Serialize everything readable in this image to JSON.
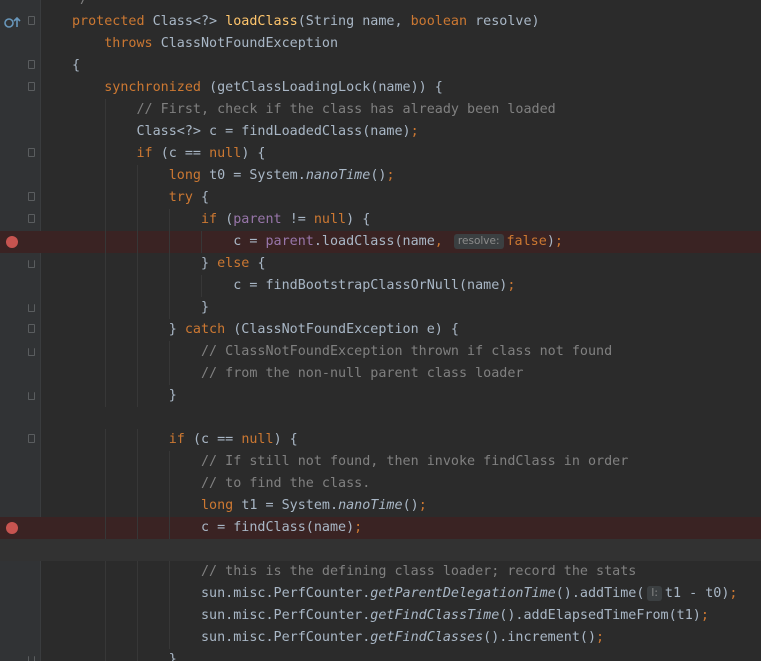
{
  "editor": {
    "lines": [
      {
        "segments": [
          {
            "t": "*/",
            "c": "cm"
          }
        ],
        "indent": 0
      },
      {
        "segments": [
          {
            "t": "protected ",
            "c": "kw"
          },
          {
            "t": "Class<?> "
          },
          {
            "t": "loadClass",
            "c": "fn"
          },
          {
            "t": "(String name, "
          },
          {
            "t": "boolean ",
            "c": "kw"
          },
          {
            "t": "resolve)"
          }
        ]
      },
      {
        "segments": [
          {
            "t": "    throws ",
            "c": "kw"
          },
          {
            "t": "ClassNotFoundException"
          }
        ]
      },
      {
        "segments": [
          {
            "t": "{"
          }
        ]
      },
      {
        "segments": [
          {
            "t": "    synchronized ",
            "c": "kw"
          },
          {
            "t": "(getClassLoadingLock(name)) {"
          }
        ]
      },
      {
        "segments": [
          {
            "t": "        // First, check if the class has already been loaded",
            "c": "cm"
          }
        ]
      },
      {
        "segments": [
          {
            "t": "        Class<?> c = findLoadedClass(name)"
          },
          {
            "t": ";",
            "c": "kw"
          }
        ]
      },
      {
        "segments": [
          {
            "t": "        "
          },
          {
            "t": "if ",
            "c": "kw"
          },
          {
            "t": "(c == "
          },
          {
            "t": "null",
            "c": "kw"
          },
          {
            "t": ") {"
          }
        ]
      },
      {
        "segments": [
          {
            "t": "            "
          },
          {
            "t": "long ",
            "c": "kw"
          },
          {
            "t": "t0 = System."
          },
          {
            "t": "nanoTime",
            "c": "it2"
          },
          {
            "t": "()"
          },
          {
            "t": ";",
            "c": "kw"
          }
        ]
      },
      {
        "segments": [
          {
            "t": "            "
          },
          {
            "t": "try ",
            "c": "kw"
          },
          {
            "t": "{"
          }
        ]
      },
      {
        "segments": [
          {
            "t": "                "
          },
          {
            "t": "if ",
            "c": "kw"
          },
          {
            "t": "("
          },
          {
            "t": "parent ",
            "c": "fld"
          },
          {
            "t": "!= "
          },
          {
            "t": "null",
            "c": "kw"
          },
          {
            "t": ") {"
          }
        ]
      },
      {
        "segments": [
          {
            "t": "                    c = "
          },
          {
            "t": "parent",
            "c": "fld"
          },
          {
            "t": ".loadClass(name"
          },
          {
            "t": ", ",
            "c": "kw"
          },
          {
            "t": "resolve:",
            "c": "hint"
          },
          {
            "t": "false",
            "c": "kw"
          },
          {
            "t": ")"
          },
          {
            "t": ";",
            "c": "kw"
          }
        ]
      },
      {
        "segments": [
          {
            "t": "                } "
          },
          {
            "t": "else ",
            "c": "kw"
          },
          {
            "t": "{"
          }
        ]
      },
      {
        "segments": [
          {
            "t": "                    c = findBootstrapClassOrNull(name)"
          },
          {
            "t": ";",
            "c": "kw"
          }
        ]
      },
      {
        "segments": [
          {
            "t": "                }"
          }
        ]
      },
      {
        "segments": [
          {
            "t": "            } "
          },
          {
            "t": "catch ",
            "c": "kw"
          },
          {
            "t": "(ClassNotFoundException e) {"
          }
        ]
      },
      {
        "segments": [
          {
            "t": "                // ClassNotFoundException thrown if class not found",
            "c": "cm"
          }
        ]
      },
      {
        "segments": [
          {
            "t": "                // from the non-null parent class loader",
            "c": "cm"
          }
        ]
      },
      {
        "segments": [
          {
            "t": "            }"
          }
        ]
      },
      {
        "segments": [
          {
            "t": ""
          }
        ]
      },
      {
        "segments": [
          {
            "t": "            "
          },
          {
            "t": "if ",
            "c": "kw"
          },
          {
            "t": "(c == "
          },
          {
            "t": "null",
            "c": "kw"
          },
          {
            "t": ") {"
          }
        ]
      },
      {
        "segments": [
          {
            "t": "                // If still not found, then invoke findClass in order",
            "c": "cm"
          }
        ]
      },
      {
        "segments": [
          {
            "t": "                // to find the class.",
            "c": "cm"
          }
        ]
      },
      {
        "segments": [
          {
            "t": "                "
          },
          {
            "t": "long ",
            "c": "kw"
          },
          {
            "t": "t1 = System."
          },
          {
            "t": "nanoTime",
            "c": "it2"
          },
          {
            "t": "()"
          },
          {
            "t": ";",
            "c": "kw"
          }
        ]
      },
      {
        "segments": [
          {
            "t": "                c = findClass(name)"
          },
          {
            "t": ";",
            "c": "kw"
          }
        ]
      },
      {
        "segments": [
          {
            "t": ""
          }
        ]
      },
      {
        "segments": [
          {
            "t": "                // this is the defining class loader; record the stats",
            "c": "cm"
          }
        ]
      },
      {
        "segments": [
          {
            "t": "                sun.misc.PerfCounter."
          },
          {
            "t": "getParentDelegationTime",
            "c": "it2"
          },
          {
            "t": "().addTime("
          },
          {
            "t": "l:",
            "c": "hint"
          },
          {
            "t": "t1 - t0)"
          },
          {
            "t": ";",
            "c": "kw"
          }
        ]
      },
      {
        "segments": [
          {
            "t": "                sun.misc.PerfCounter."
          },
          {
            "t": "getFindClassTime",
            "c": "it2"
          },
          {
            "t": "().addElapsedTimeFrom(t1)"
          },
          {
            "t": ";",
            "c": "kw"
          }
        ]
      },
      {
        "segments": [
          {
            "t": "                sun.misc.PerfCounter."
          },
          {
            "t": "getFindClasses",
            "c": "it2"
          },
          {
            "t": "().increment()"
          },
          {
            "t": ";",
            "c": "kw"
          }
        ]
      },
      {
        "segments": [
          {
            "t": "            }"
          }
        ]
      }
    ],
    "breakpoint_lines": [
      11,
      24
    ],
    "caret_line": 25,
    "implements_icon_line": 1,
    "colors": {
      "background": "#2b2b2b",
      "gutter": "#313335",
      "keyword": "#cc7832",
      "method": "#ffc66d",
      "comment": "#808080",
      "field": "#9876aa",
      "breakpoint": "#c75450",
      "breakpoint_line": "#3a2323"
    }
  }
}
